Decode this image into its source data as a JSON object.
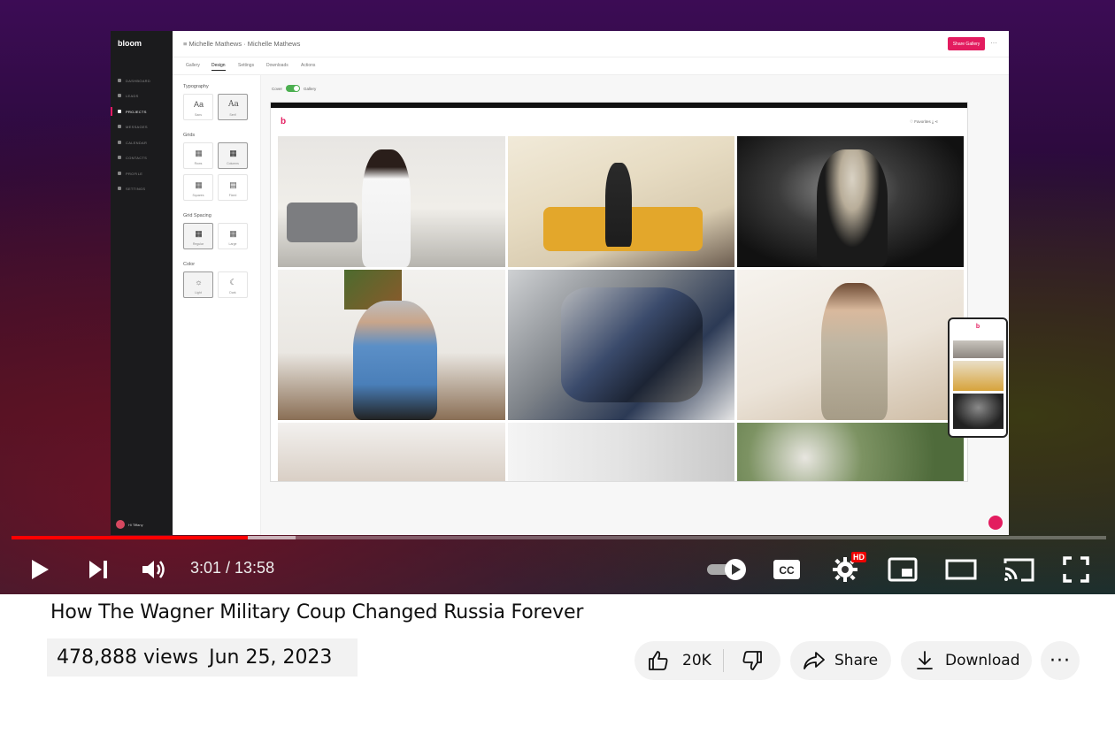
{
  "app": {
    "logo": "bloom",
    "breadcrumb": "≡  Michelle Mathews  ·  Michelle Mathews",
    "share_label": "Share Gallery",
    "more_label": "···",
    "sidebar_items": [
      "DASHBOARD",
      "LEADS",
      "PROJECTS",
      "MESSAGES",
      "CALENDAR",
      "CONTACTS",
      "PROFILE",
      "SETTINGS"
    ],
    "active_item": "PROJECTS",
    "user": "Hi Tiffany",
    "tabs": [
      "Gallery",
      "Design",
      "Settings",
      "Downloads",
      "Actions"
    ],
    "active_tab": "Design",
    "panel": {
      "typography_heading": "Typography",
      "typo_sans": "Sans",
      "typo_serif": "Serif",
      "grids_heading": "Grids",
      "grid_rows": "Rows",
      "grid_columns": "Columns",
      "grid_squares": "Squares",
      "grid_fixed": "Fixed",
      "spacing_heading": "Grid Spacing",
      "spacing_regular": "Regular",
      "spacing_large": "Large",
      "color_heading": "Color",
      "color_light": "Light",
      "color_dark": "Dark"
    },
    "toggle_left": "Cover",
    "toggle_right": "Gallery",
    "preview_logo": "b",
    "preview_favorites": "♡ Favorites  ⤓  ⋖"
  },
  "player": {
    "time": "3:01 / 13:58",
    "progress_played": 0.2158,
    "progress_buffered": 0.2595,
    "hd_badge": "HD",
    "cc_label": "CC"
  },
  "video": {
    "title": "How The Wagner Military Coup Changed Russia Forever",
    "views": "478,888 views",
    "date": "Jun 25, 2023"
  },
  "actions": {
    "likes": "20K",
    "share": "Share",
    "download": "Download",
    "more": "···"
  },
  "colors": {
    "accent": "#e31c5f",
    "progress": "#ff0000",
    "pill_bg": "#f2f2f2"
  }
}
